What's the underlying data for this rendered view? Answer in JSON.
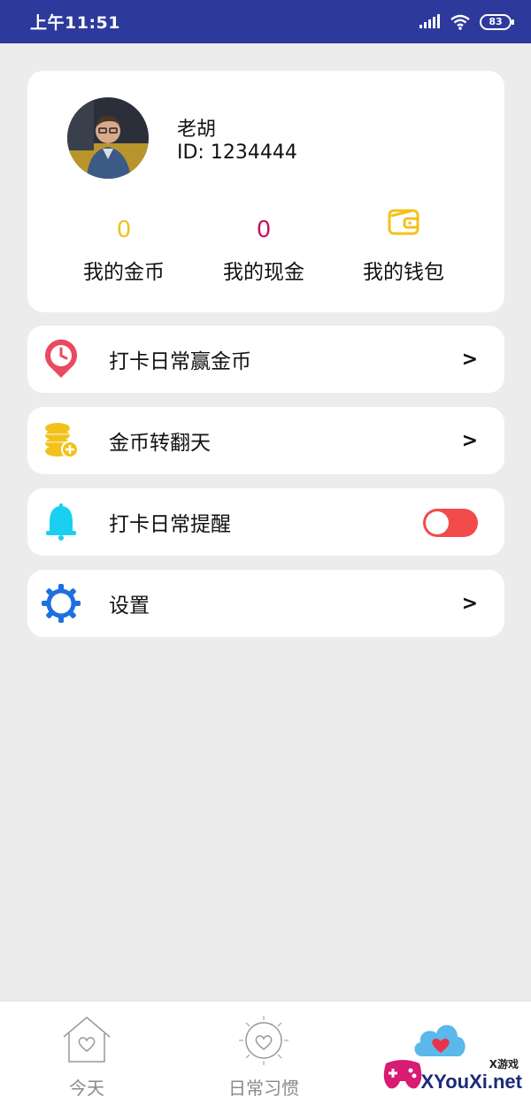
{
  "status_bar": {
    "time": "上午11:51",
    "battery": "83"
  },
  "profile": {
    "name": "老胡",
    "id": "ID: 1234444",
    "stats": [
      {
        "value": "0",
        "label": "我的金币",
        "color": "#f2c21b"
      },
      {
        "value": "0",
        "label": "我的现金",
        "color": "#c2185b"
      },
      {
        "icon": "wallet-icon",
        "label": "我的钱包",
        "color": "#f2c21b"
      }
    ]
  },
  "menu": [
    {
      "label": "打卡日常赢金币",
      "icon": "clock-pin-icon",
      "arrow": ">"
    },
    {
      "label": "金币转翻天",
      "icon": "coins-icon",
      "arrow": ">"
    },
    {
      "label": "打卡日常提醒",
      "icon": "bell-icon",
      "toggle_on": false,
      "toggle_color": "#f24b4b"
    },
    {
      "label": "设置",
      "icon": "gear-icon",
      "arrow": ">"
    }
  ],
  "tabs": [
    {
      "label": "今天",
      "icon": "house-heart-icon"
    },
    {
      "label": "日常习惯",
      "icon": "sun-heart-icon"
    },
    {
      "label": "",
      "icon": "cloud-heart-icon"
    }
  ],
  "watermark": {
    "small": "X游戏",
    "big": "XYouXi.net"
  }
}
